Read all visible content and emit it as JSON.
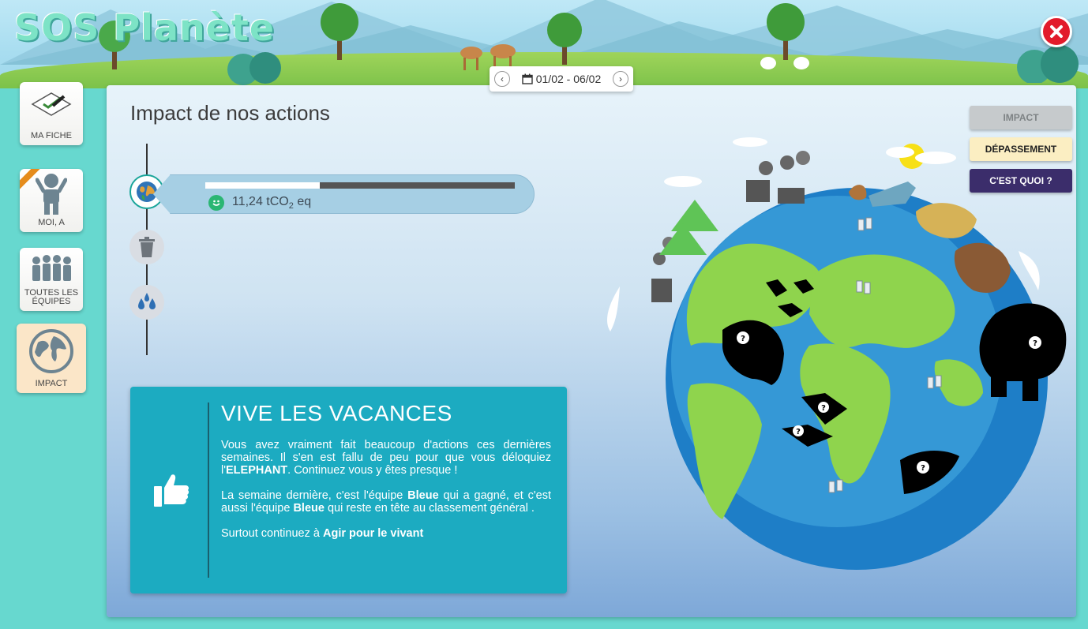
{
  "app": {
    "title": "SOS Planète"
  },
  "header": {
    "date_range": "01/02 - 06/02",
    "prev_icon": "chevron-left-icon",
    "next_icon": "chevron-right-icon",
    "calendar_icon": "calendar-icon",
    "close_icon": "close-icon",
    "close_color": "#e21b2b"
  },
  "sidebar": {
    "items": [
      {
        "label": "MA FICHE",
        "icon": "sheet-icon"
      },
      {
        "label": "MOI, A",
        "icon": "person-icon"
      },
      {
        "label": "TOUTES LES ÉQUIPES",
        "icon": "teams-icon"
      },
      {
        "label": "IMPACT",
        "icon": "globe-icon",
        "active": true
      }
    ]
  },
  "main": {
    "title": "Impact de nos actions",
    "timeline": [
      {
        "icon": "earth-icon",
        "active": true
      },
      {
        "icon": "trash-icon",
        "active": false
      },
      {
        "icon": "water-drops-icon",
        "active": false
      }
    ],
    "progress": {
      "fraction": 0.37,
      "value": "11,24 tCO",
      "subscript": "2",
      "unit": " eq"
    },
    "message": {
      "title": "VIVE LES VACANCES",
      "p1_a": "Vous avez vraiment fait beaucoup d'actions ces dernières semaines. Il s'en est fallu de peu pour que vous déloquiez l'",
      "p1_b": "ELEPHANT",
      "p1_c": ". Continuez vous y êtes presque !",
      "p2_a": "La semaine dernière, c'est l'équipe ",
      "p2_b": "Bleue",
      "p2_c": " qui a gagné, et c'est aussi l'équipe ",
      "p2_d": "Bleue",
      "p2_e": " qui reste en tête au classement général .",
      "p3_a": "Surtout continuez à ",
      "p3_b": "Agir pour le vivant"
    },
    "buttons": [
      {
        "label": "IMPACT",
        "bg": "#c6cacc",
        "color": "#7e8385"
      },
      {
        "label": "DÉPASSEMENT",
        "bg": "#fbeec2",
        "color": "#222222"
      },
      {
        "label": "C'EST QUOI ?",
        "bg": "#3b2d6b",
        "color": "#ffffff"
      }
    ]
  },
  "colors": {
    "accent": "#1cabc1",
    "sidebar_active": "#fbe6c8",
    "background": "#67d8cf"
  }
}
